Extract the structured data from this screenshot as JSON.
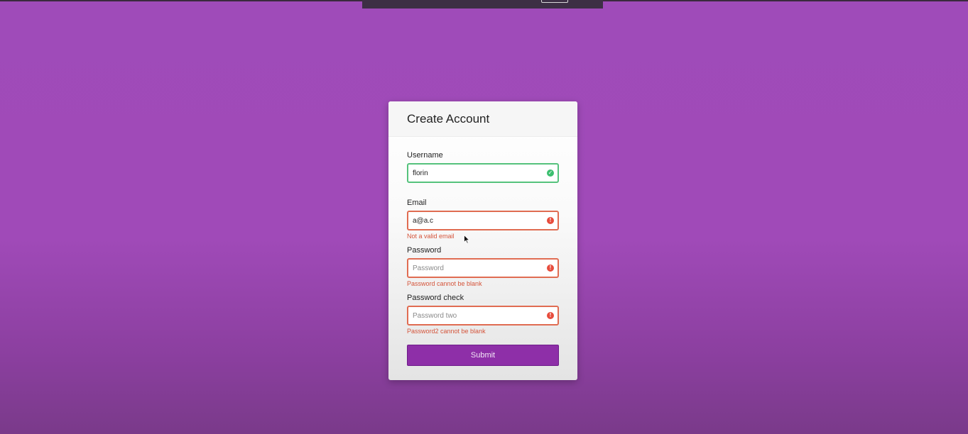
{
  "form": {
    "title": "Create Account",
    "fields": [
      {
        "label": "Username",
        "value": "florin",
        "placeholder": "",
        "state": "success",
        "error": ""
      },
      {
        "label": "Email",
        "value": "a@a.c",
        "placeholder": "",
        "state": "error",
        "error": "Not a valid email"
      },
      {
        "label": "Password",
        "value": "",
        "placeholder": "Password",
        "state": "error",
        "error": "Password cannot be blank"
      },
      {
        "label": "Password check",
        "value": "",
        "placeholder": "Password two",
        "state": "error",
        "error": "Password2 cannot be blank"
      }
    ],
    "submit_label": "Submit"
  },
  "icons": {
    "success": "check-circle-icon",
    "error": "exclamation-circle-icon"
  },
  "colors": {
    "background": "#a04ab8",
    "success": "#55c27c",
    "error": "#e06c52",
    "error_text": "#d4543a",
    "button": "#8e2fa8"
  }
}
